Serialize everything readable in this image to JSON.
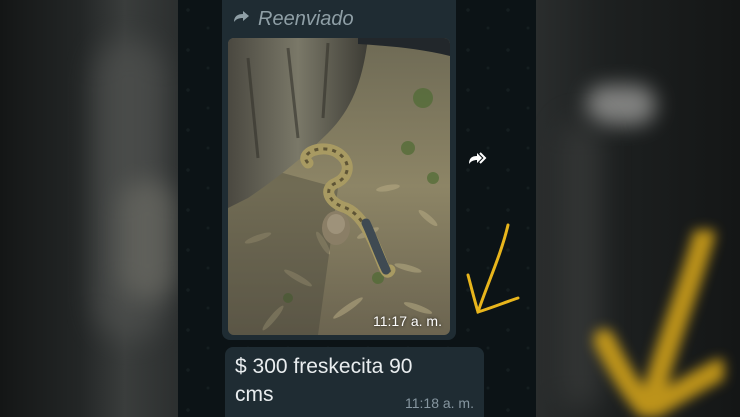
{
  "chat": {
    "forwarded_label": "Reenviado",
    "image_message": {
      "time": "11:17 a. m."
    },
    "text_message": {
      "text": "$ 300 freskecita 90 cms",
      "time": "11:18 a. m."
    }
  },
  "colors": {
    "chat_background": "#0c1316",
    "bubble": "#1f2c33",
    "meta_text": "#8696a0",
    "annotation_arrow": "#e8b51c"
  },
  "icons": {
    "forwarded": "forward-arrow-icon",
    "share": "forward-double-arrow-icon",
    "annotation": "hand-drawn-arrow-icon"
  }
}
